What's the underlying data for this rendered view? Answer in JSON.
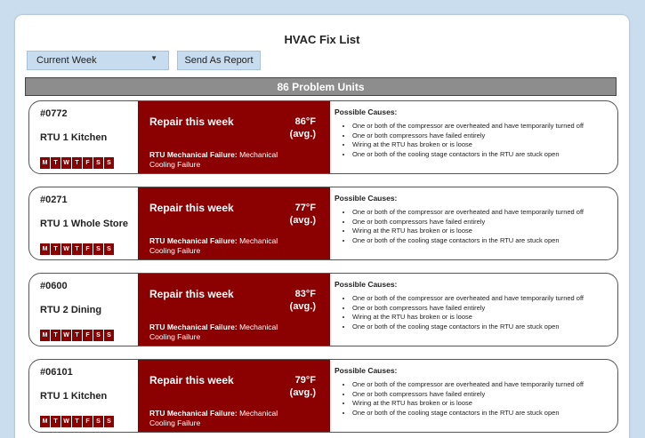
{
  "page": {
    "title": "HVAC Fix List"
  },
  "toolbar": {
    "week_select": "Current Week",
    "send_label": "Send As Report"
  },
  "summary": {
    "count_label": "86 Problem Units"
  },
  "labels": {
    "repair": "Repair this week",
    "avg": "(avg.)",
    "failure_prefix": "RTU Mechanical Failure:",
    "causes_title": "Possible Causes:"
  },
  "days": [
    "M",
    "T",
    "W",
    "T",
    "F",
    "S",
    "S"
  ],
  "units": [
    {
      "id": "#0772",
      "name": "RTU 1 Kitchen",
      "temp": "86°F",
      "failure": "Mechanical Cooling Failure",
      "causes": [
        "One or both of the compressor are overheated and have temporarily turned off",
        "One or both compressors have failed entirely",
        "Wiring at the RTU has broken or is loose",
        "One or both of the cooling stage contactors in the RTU are stuck open"
      ]
    },
    {
      "id": "#0271",
      "name": "RTU 1 Whole Store",
      "temp": "77°F",
      "failure": "Mechanical Cooling Failure",
      "causes": [
        "One or both of the compressor are overheated and have temporarily turned off",
        "One or both compressors have failed entirely",
        "Wiring at the RTU has broken or is loose",
        "One or both of the cooling stage contactors in the RTU are stuck open"
      ]
    },
    {
      "id": "#0600",
      "name": "RTU 2 Dining",
      "temp": "83°F",
      "failure": "Mechanical Cooling Failure",
      "causes": [
        "One or both of the compressor are overheated and have temporarily turned off",
        "One or both compressors have failed entirely",
        "Wiring at the RTU has broken or is loose",
        "One or both of the cooling stage contactors in the RTU are stuck open"
      ]
    },
    {
      "id": "#06101",
      "name": "RTU 1 Kitchen",
      "temp": "79°F",
      "failure": "Mechanical Cooling Failure",
      "causes": [
        "One or both of the compressor are overheated and have temporarily turned off",
        "One or both compressors have failed entirely",
        "Wiring at the RTU has broken or is loose",
        "One or both of the cooling stage contactors in the RTU are stuck open"
      ]
    }
  ],
  "colors": {
    "alert": "#8b0000",
    "accent": "#c7dcef",
    "background": "#c9ddef",
    "bar": "#8d8d8d"
  }
}
